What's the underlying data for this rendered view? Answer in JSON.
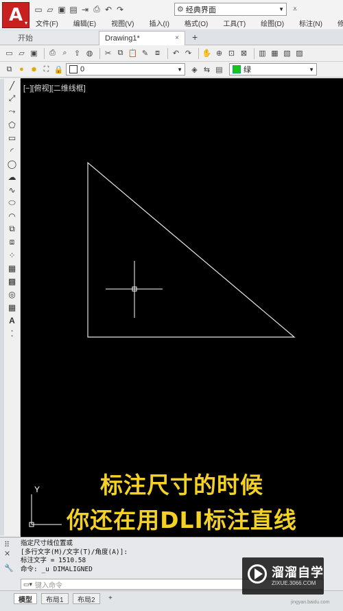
{
  "app": {
    "logo_letter": "A",
    "logo_sub": "▾"
  },
  "quick_access": {
    "icons": [
      "new-icon",
      "open-icon",
      "save-icon",
      "save-as-icon",
      "export-icon",
      "print-icon",
      "undo-icon",
      "redo-icon"
    ],
    "workspace": "经典界面"
  },
  "menu": [
    "文件(F)",
    "编辑(E)",
    "视图(V)",
    "插入(I)",
    "格式(O)",
    "工具(T)",
    "绘图(D)",
    "标注(N)",
    "修"
  ],
  "tabs": {
    "start": "开始",
    "active": "Drawing1*",
    "close": "×",
    "add": "+"
  },
  "properties": {
    "layer_value": "0",
    "color_value": "绿",
    "color_hex": "#19c519"
  },
  "viewport_label": "[−][俯视][二维线框]",
  "ucs": {
    "y_label": "Y"
  },
  "caption": {
    "line1": "标注尺寸的时候",
    "line2": "你还在用DLI标注直线",
    "color": "#f4d125"
  },
  "command_history": [
    "指定尺寸线位置或",
    "[多行文字(M)/文字(T)/角度(A)]:",
    "标注文字 = 1510.58",
    "命令: _u DIMALIGNED"
  ],
  "command_input_placeholder": "键入命令",
  "layout_tabs": [
    "模型",
    "布局1",
    "布局2",
    "+"
  ],
  "watermark": {
    "title": "溜溜自学",
    "url": "ZIXUE.3066.COM",
    "small": "jingyan.baidu.com"
  }
}
